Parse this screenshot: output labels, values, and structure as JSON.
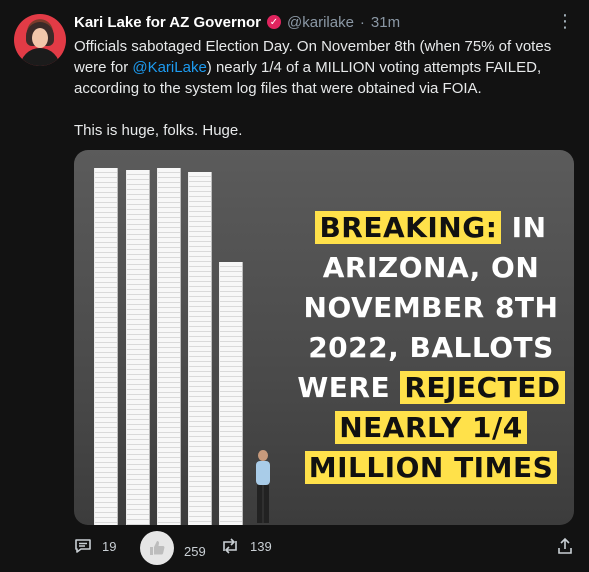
{
  "tweet": {
    "author_name": "Kari Lake for AZ Governor",
    "verified_icon": "verified-badge-icon",
    "handle": "@karilake",
    "separator": "·",
    "time": "31m",
    "more_icon": "more-options-icon",
    "text_part1": "Officials sabotaged Election Day. On November 8th (when 75% of votes were for ",
    "mention": "@KariLake",
    "text_part2": ") nearly 1/4 of a MILLION voting attempts FAILED, according to the system log files that were obtained via FOIA.",
    "text_line2": "This is huge, folks. Huge."
  },
  "media": {
    "line1_highlight": "BREAKING:",
    "line1_rest": " IN",
    "line2": "ARIZONA, ON",
    "line3": "NOVEMBER 8TH",
    "line4": "2022, BALLOTS",
    "line5_plain": "WERE ",
    "line5_highlight": "REJECTED",
    "line6_highlight": "NEARLY 1/4",
    "line7_highlight": "MILLION TIMES",
    "highlight_color": "#ffe14a"
  },
  "actions": {
    "reply_count": "19",
    "like_count": "259",
    "retweet_count": "139",
    "reply_icon": "reply-icon",
    "like_icon": "thumbs-up-icon",
    "retweet_icon": "retweet-icon",
    "share_icon": "share-icon"
  }
}
